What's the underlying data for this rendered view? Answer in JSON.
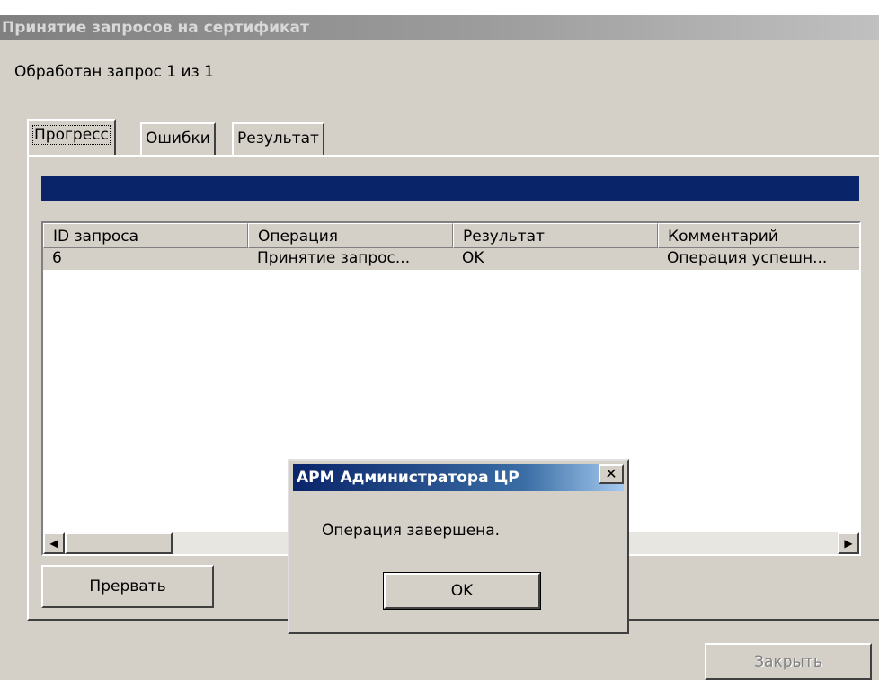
{
  "window": {
    "title": "Принятие запросов на сертификат"
  },
  "status": {
    "text": "Обработан запрос 1 из 1"
  },
  "tabs": [
    {
      "label": "Прогресс",
      "active": true
    },
    {
      "label": "Ошибки",
      "active": false
    },
    {
      "label": "Результат",
      "active": false
    }
  ],
  "progress": {
    "percent": 100,
    "color": "#0a246a"
  },
  "table": {
    "columns": [
      "ID запроса",
      "Операция",
      "Результат",
      "Комментарий"
    ],
    "rows": [
      [
        "6",
        "Принятие запрос...",
        "OK",
        "Операция успешн..."
      ]
    ]
  },
  "buttons": {
    "abort": "Прервать",
    "close": "Закрыть"
  },
  "dialog": {
    "title": "АРМ Администратора ЦР",
    "message": "Операция завершена.",
    "ok": "OK",
    "close_glyph": "✕"
  }
}
